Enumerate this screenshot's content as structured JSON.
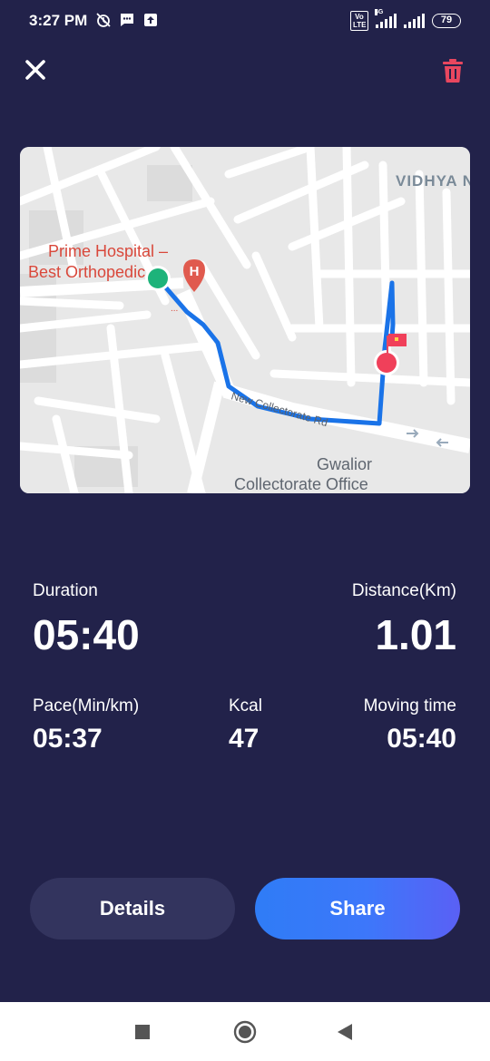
{
  "status_bar": {
    "time": "3:27 PM",
    "volte_label": "Vo LTE",
    "network_type": "4G",
    "battery": "79",
    "icons": [
      "alarm-off-icon",
      "message-icon",
      "upload-icon",
      "volte-icon",
      "signal-icon",
      "battery-icon"
    ]
  },
  "top_bar": {
    "close_icon": "close-icon",
    "delete_icon": "trash-icon",
    "delete_color": "#e8475f"
  },
  "map": {
    "labels": {
      "hospital_line1": "Prime Hospital –",
      "hospital_line2": "Best Orthopedic",
      "area": "VIDHYA N",
      "road": "New Collectorate Rd",
      "office_line1": "Gwalior",
      "office_line2": "Collectorate Office"
    },
    "hospital_icon": "hospital-marker-icon",
    "start_marker_color": "#1db37a",
    "end_marker_color": "#f0405a",
    "route_color": "#1a73e8",
    "label_red": "#d9483b"
  },
  "stats": {
    "duration": {
      "label": "Duration",
      "value": "05:40"
    },
    "distance": {
      "label": "Distance(Km)",
      "value": "1.01"
    },
    "pace": {
      "label": "Pace(Min/km)",
      "value": "05:37"
    },
    "kcal": {
      "label": "Kcal",
      "value": "47"
    },
    "moving_time": {
      "label": "Moving time",
      "value": "05:40"
    }
  },
  "buttons": {
    "details": "Details",
    "share": "Share"
  },
  "nav_bar": {
    "icons": [
      "recents-square-icon",
      "home-circle-icon",
      "back-triangle-icon"
    ]
  },
  "colors": {
    "background": "#22224a",
    "details_button": "#33345e",
    "share_gradient_start": "#2f7cf6",
    "share_gradient_end": "#5a60f5"
  }
}
